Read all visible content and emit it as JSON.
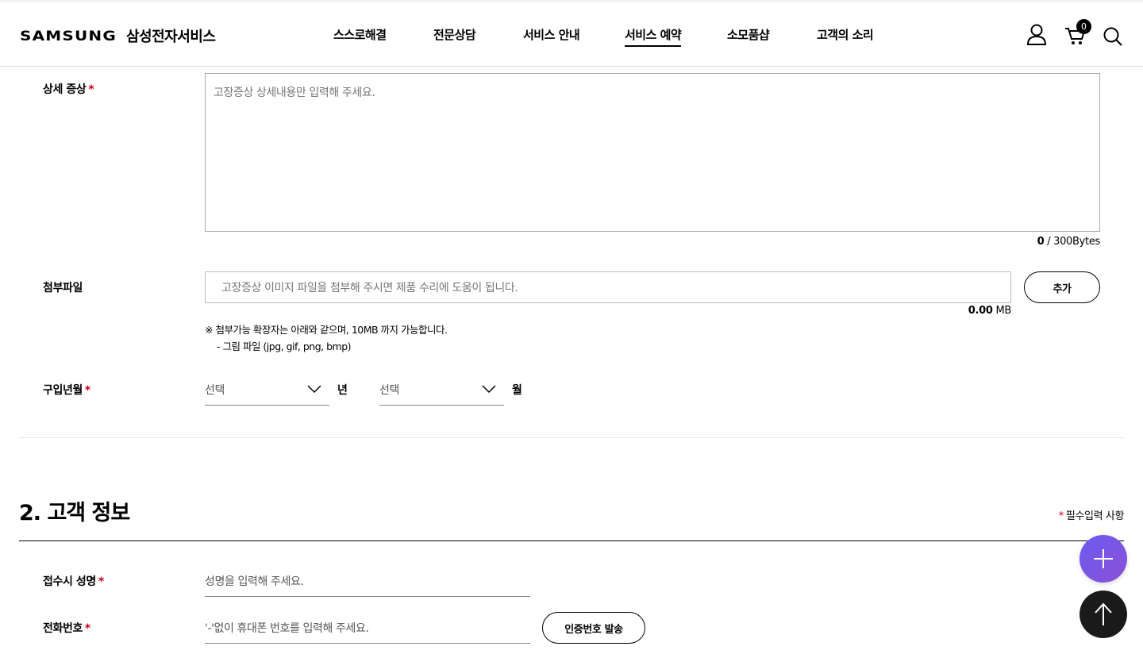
{
  "header": {
    "logo_word": "SAMSUNG",
    "logo_sub": "삼성전자서비스",
    "nav": [
      {
        "label": "스스로해결"
      },
      {
        "label": "전문상담"
      },
      {
        "label": "서비스 안내"
      },
      {
        "label": "서비스 예약",
        "active": true
      },
      {
        "label": "소모품샵"
      },
      {
        "label": "고객의 소리"
      }
    ],
    "cart_count": "0"
  },
  "form": {
    "detail": {
      "label": "상세 증상",
      "required_mark": "*",
      "placeholder": "고장증상 상세내용만 입력해 주세요.",
      "byte_count": "0",
      "byte_limit": " / 300Bytes"
    },
    "attachment": {
      "label": "첨부파일",
      "placeholder": "고장증상 이미지 파일을 첨부해 주시면 제품 수리에 도움이 됩니다.",
      "add_button": "추가",
      "size_value": "0.00",
      "size_unit": " MB",
      "note1": "※ 첨부가능 확장자는 아래와 같으며, 10MB 까지 가능합니다.",
      "note2": "- 그림 파일 (jpg, gif, png, bmp)"
    },
    "purchase": {
      "label": "구입년월",
      "required_mark": "*",
      "year_select": "선택",
      "year_unit": "년",
      "month_select": "선택",
      "month_unit": "월"
    }
  },
  "customer": {
    "title": "2. 고객 정보",
    "required_star": "*",
    "required_note": "필수입력 사항",
    "name": {
      "label": "접수시 성명",
      "required_mark": "*",
      "placeholder": "성명을 입력해 주세요."
    },
    "phone": {
      "label": "전화번호",
      "required_mark": "*",
      "placeholder": "'-'없이 휴대폰 번호를 입력해 주세요.",
      "verify_button": "인증번호 발송"
    }
  },
  "icons": {
    "user": "user-icon",
    "cart": "cart-icon",
    "search": "search-icon",
    "plus": "plus-icon",
    "top": "arrow-up-icon"
  },
  "colors": {
    "required": "#c4001a",
    "fab_gradient_start": "#6a5cf0",
    "fab_gradient_end": "#8c4fd6",
    "top_button": "#1a1a1a"
  }
}
